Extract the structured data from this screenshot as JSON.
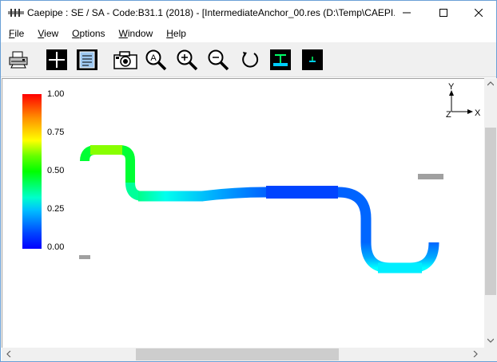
{
  "window": {
    "title": "Caepipe : SE / SA - Code:B31.1 (2018) -  [IntermediateAnchor_00.res (D:\\Temp\\CAEPI...",
    "controls": {
      "minimize": "minimize-icon",
      "maximize": "maximize-icon",
      "close": "close-icon"
    }
  },
  "menu": {
    "items": [
      {
        "label": "File",
        "accel": "F"
      },
      {
        "label": "View",
        "accel": "V"
      },
      {
        "label": "Options",
        "accel": "O"
      },
      {
        "label": "Window",
        "accel": "W"
      },
      {
        "label": "Help",
        "accel": "H"
      }
    ]
  },
  "toolbar": {
    "buttons": [
      {
        "name": "print-button",
        "icon": "printer-icon"
      },
      {
        "name": "crosshair-button",
        "icon": "crosshair-icon"
      },
      {
        "name": "list-button",
        "icon": "list-icon"
      },
      {
        "name": "camera-button",
        "icon": "camera-icon"
      },
      {
        "name": "zoom-all-button",
        "icon": "zoom-all-icon",
        "glyph": "A"
      },
      {
        "name": "zoom-in-button",
        "icon": "zoom-in-icon",
        "glyph": "+"
      },
      {
        "name": "zoom-out-button",
        "icon": "zoom-out-icon",
        "glyph": "−"
      },
      {
        "name": "rotate-button",
        "icon": "rotate-icon"
      },
      {
        "name": "support-view-button",
        "icon": "support-icon"
      },
      {
        "name": "anchor-view-button",
        "icon": "anchor-icon"
      }
    ]
  },
  "legend": {
    "labels": [
      "1.00",
      "0.75",
      "0.50",
      "0.25",
      "0.00"
    ],
    "colors": [
      "#ff0000",
      "#ffff00",
      "#00ff00",
      "#00ffcc",
      "#0000ff"
    ]
  },
  "axes": {
    "y": "Y",
    "z": "Z",
    "x": "X"
  },
  "colors": {
    "accent": "#0078d7",
    "support": "#a0a0a0"
  }
}
